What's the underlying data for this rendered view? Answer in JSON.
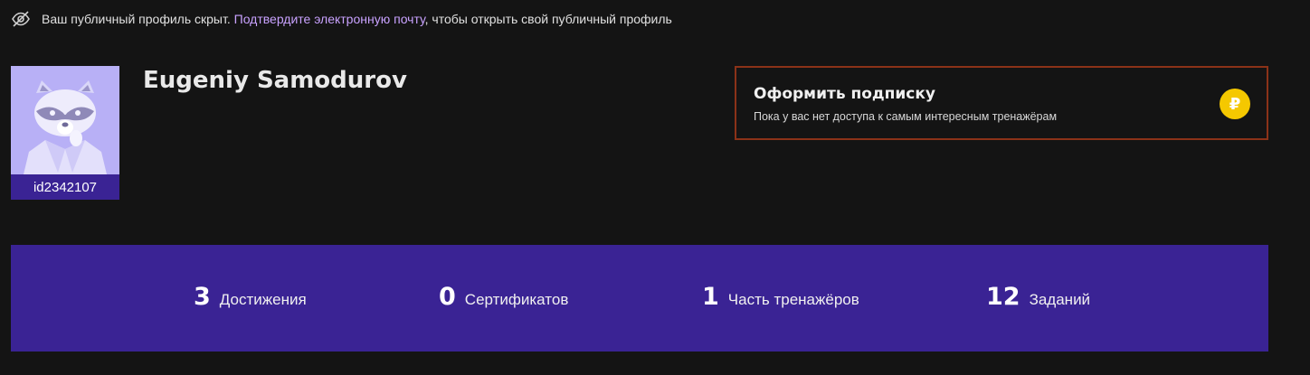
{
  "notice": {
    "icon": "eye-off-icon",
    "text_before": "Ваш публичный профиль скрыт.",
    "link_text": "Подтвердите электронную почту",
    "text_after": ", чтобы открыть свой публичный профиль",
    "link_color": "#c9a2ff"
  },
  "profile": {
    "name": "Eugeniy Samodurov",
    "id": "id2342107"
  },
  "subscription": {
    "title": "Оформить подписку",
    "description": "Пока у вас нет доступа к самым интересным тренажёрам",
    "coin_symbol": "₽",
    "border_color": "#8b3218",
    "coin_color": "#f5c800"
  },
  "stats": [
    {
      "value": "3",
      "label": "Достижения"
    },
    {
      "value": "0",
      "label": "Сертификатов"
    },
    {
      "value": "1",
      "label": "Часть тренажёров"
    },
    {
      "value": "12",
      "label": "Заданий"
    }
  ],
  "colors": {
    "background": "#141414",
    "accent_purple": "#3a2394"
  }
}
